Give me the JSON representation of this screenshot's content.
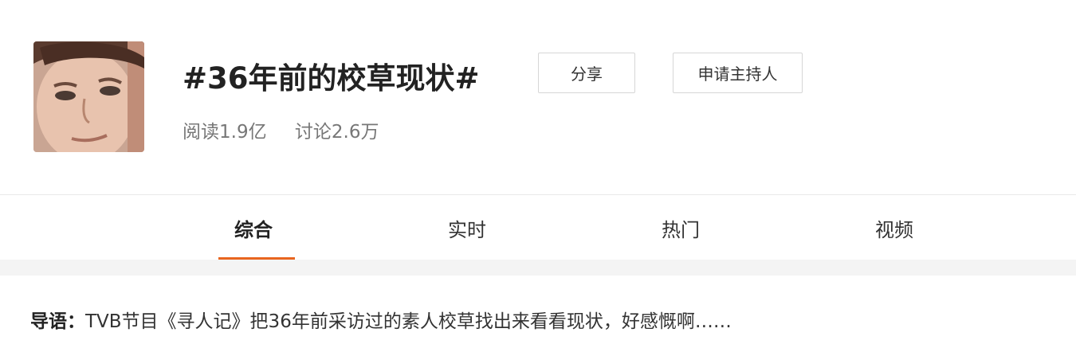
{
  "topic": {
    "title": "#36年前的校草现状#",
    "avatar_icon": "person-face-photo",
    "share_label": "分享",
    "apply_host_label": "申请主持人",
    "reads": "阅读1.9亿",
    "discussions": "讨论2.6万"
  },
  "tabs": [
    {
      "label": "综合",
      "active": true
    },
    {
      "label": "实时",
      "active": false
    },
    {
      "label": "热门",
      "active": false
    },
    {
      "label": "视频",
      "active": false
    }
  ],
  "summary": {
    "label": "导语：",
    "text": "TVB节目《寻人记》把36年前采访过的素人校草找出来看看现状，好感慨啊……"
  },
  "colors": {
    "accent": "#e8651f",
    "background": "#f4f4f4",
    "panel": "#ffffff"
  }
}
